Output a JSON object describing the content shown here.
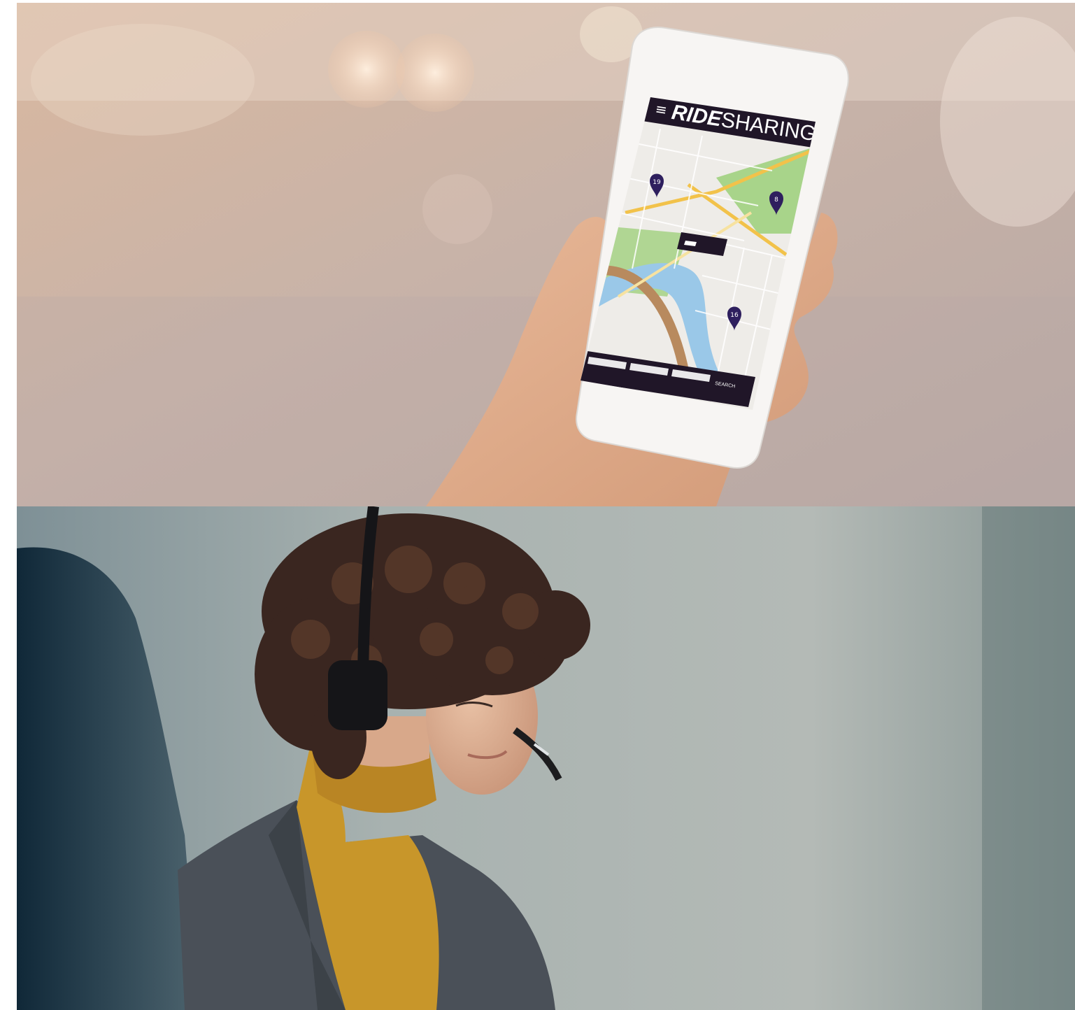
{
  "top_photo": {
    "app_logo_bold": "RIDE",
    "app_logo_light": "SHARING",
    "menu_glyph": "≡",
    "search_button_label": "SEARCH",
    "map_pins": [
      "19",
      "8",
      "16"
    ],
    "colors": {
      "app_header": "#201628",
      "pin": "#2e1f5e",
      "river": "#9ac8e8",
      "park": "#a8d48a",
      "major_road": "#f2c24a"
    }
  },
  "bottom_photo": {
    "colors": {
      "sweater": "#c8962a",
      "blazer": "#4a5058",
      "background": "#a8b0ae"
    }
  }
}
